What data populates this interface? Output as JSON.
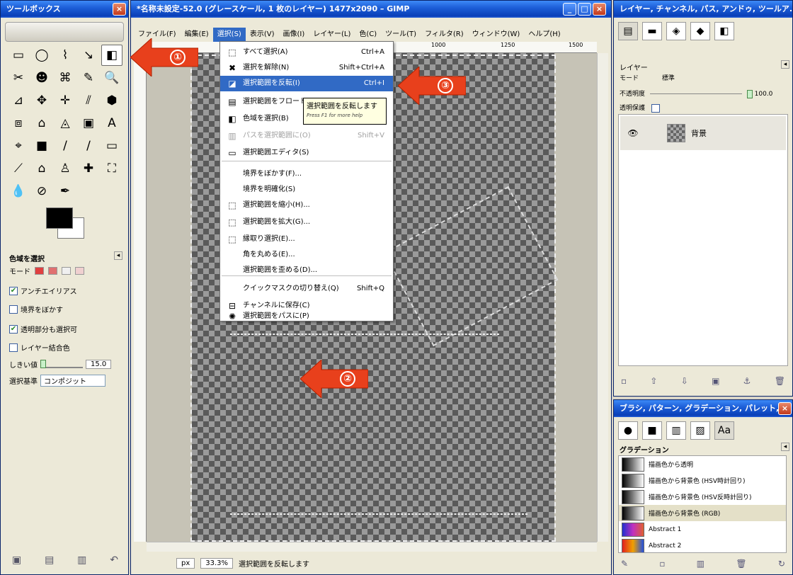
{
  "toolbox": {
    "title": "ツールボックス",
    "close": "×",
    "tools": [
      "▭",
      "◯",
      "⌇",
      "↘",
      "◧",
      "✂",
      "☻",
      "⌘",
      "✎",
      "🔍",
      "⊿",
      "✥",
      "✛",
      "⫽",
      "⬢",
      "⧈",
      "⌂",
      "◬",
      "▣",
      "A",
      "⌖",
      "■",
      "/",
      "∕",
      "▭",
      "⟋",
      "⌂",
      "♙",
      "✚",
      "⛶",
      "💧",
      "⊘",
      "✒"
    ],
    "options_title": "色域を選択",
    "mode_label": "モード",
    "antialias_label": "アンチエイリアス",
    "feather_label": "境界をぼかす",
    "transparent_label": "透明部分も選択可",
    "sample_merged_label": "レイヤー結合色",
    "threshold_label": "しきい値",
    "threshold_value": "15.0",
    "select_by_label": "選択基準",
    "select_by_value": "コンポジット",
    "options_icon": "◂"
  },
  "main": {
    "title": "*名称未設定-52.0 (グレースケール, 1 枚のレイヤー) 1477x2090 – GIMP",
    "menu": [
      "ファイル(F)",
      "編集(E)",
      "選択(S)",
      "表示(V)",
      "画像(I)",
      "レイヤー(L)",
      "色(C)",
      "ツール(T)",
      "フィルタ(R)",
      "ウィンドウ(W)",
      "ヘルプ(H)"
    ],
    "ruler": [
      "1000",
      "1250",
      "1500"
    ],
    "status_unit": "px",
    "status_zoom": "33.3%",
    "status_text": "選択範囲を反転します"
  },
  "select_menu": {
    "items": [
      {
        "label": "すべて選択(A)",
        "shortcut": "Ctrl+A",
        "icon": "⬚",
        "state": "normal"
      },
      {
        "label": "選択を解除(N)",
        "shortcut": "Shift+Ctrl+A",
        "icon": "✖",
        "state": "normal"
      },
      {
        "label": "選択範囲を反転(I)",
        "shortcut": "Ctrl+I",
        "icon": "◪",
        "state": "highlighted"
      },
      {
        "label": "選択範囲をフロート(L)",
        "shortcut": "",
        "icon": "▤",
        "state": "normal"
      },
      {
        "label": "色域を選択(B)",
        "shortcut": "",
        "icon": "◧",
        "state": "normal"
      },
      {
        "label": "パスを選択範囲に(O)",
        "shortcut": "Shift+V",
        "icon": "▥",
        "state": "disabled"
      },
      {
        "label": "選択範囲エディタ(S)",
        "shortcut": "",
        "icon": "▭",
        "state": "normal"
      },
      {
        "label": "境界をぼかす(F)...",
        "shortcut": "",
        "icon": "",
        "state": "normal"
      },
      {
        "label": "境界を明確化(S)",
        "shortcut": "",
        "icon": "",
        "state": "normal"
      },
      {
        "label": "選択範囲を縮小(H)...",
        "shortcut": "",
        "icon": "⬚",
        "state": "normal"
      },
      {
        "label": "選択範囲を拡大(G)...",
        "shortcut": "",
        "icon": "⬚",
        "state": "normal"
      },
      {
        "label": "縁取り選択(E)...",
        "shortcut": "",
        "icon": "⬚",
        "state": "normal"
      },
      {
        "label": "角を丸める(E)...",
        "shortcut": "",
        "icon": "",
        "state": "normal"
      },
      {
        "label": "選択範囲を歪める(D)...",
        "shortcut": "",
        "icon": "",
        "state": "normal"
      },
      {
        "label": "クイックマスクの切り替え(Q)",
        "shortcut": "Shift+Q",
        "icon": "",
        "state": "normal"
      },
      {
        "label": "チャンネルに保存(C)",
        "shortcut": "",
        "icon": "⊟",
        "state": "normal"
      },
      {
        "label": "選択範囲をパスに(P)",
        "shortcut": "",
        "icon": "✺",
        "state": "normal"
      }
    ],
    "tooltip": "選択範囲を反転します",
    "tooltip_hint": "Press F1 for more help"
  },
  "arrows": [
    "①",
    "②",
    "③"
  ],
  "layers_dock": {
    "title": "レイヤー, チャンネル, パス, アンドゥ, ツールア...",
    "tabs": [
      "▤",
      "▬",
      "◈",
      "◆",
      "◧"
    ],
    "panel_title": "レイヤー",
    "mode_label": "モード",
    "mode_value": "標準",
    "opacity_label": "不透明度",
    "opacity_value": "100.0",
    "lock_label": "透明保護",
    "layer_name": "背景",
    "eye": "👁",
    "bottom": [
      "▫",
      "⇧",
      "⇩",
      "▣",
      "⚓",
      "🗑"
    ]
  },
  "brush_dock": {
    "title": "ブラシ, パターン, グラデーション, パレット, フ...",
    "close": "×",
    "tabs": [
      "●",
      "■",
      "▥",
      "▨",
      "Aa"
    ],
    "panel_title": "グラデーション",
    "gradients": [
      {
        "name": "描画色から透明",
        "colors": "linear-gradient(90deg,#000,#00000000)"
      },
      {
        "name": "描画色から背景色 (HSV時計回り)",
        "colors": "linear-gradient(90deg,#000,#fff)"
      },
      {
        "name": "描画色から背景色 (HSV反時計回り)",
        "colors": "linear-gradient(90deg,#000,#fff)"
      },
      {
        "name": "描画色から背景色 (RGB)",
        "colors": "linear-gradient(90deg,#000,#fff)"
      },
      {
        "name": "Abstract 1",
        "colors": "linear-gradient(90deg,#2030d0,#c030c0,#e06030)"
      },
      {
        "name": "Abstract 2",
        "colors": "linear-gradient(90deg,#e02020,#f0a000,#2050e0)"
      }
    ],
    "bottom": [
      "✎",
      "▫",
      "▥",
      "🗑",
      "↻"
    ]
  },
  "colors": {
    "menu_highlight": "#316ac5",
    "arrow_red": "#e8401c",
    "titlebar_blue": "#1d5fd8"
  }
}
